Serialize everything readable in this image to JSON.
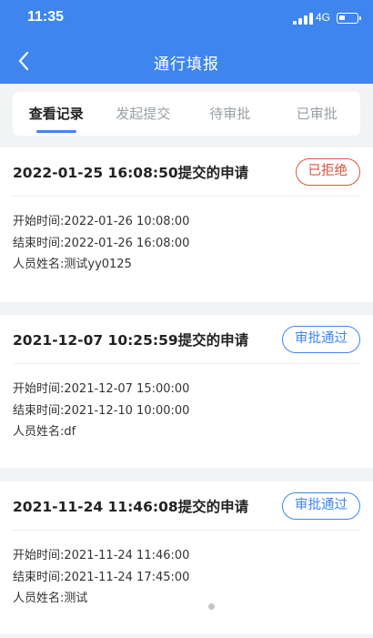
{
  "status_bar": {
    "time": "11:35",
    "network": "4G"
  },
  "header": {
    "title": "通行填报"
  },
  "tabs": [
    {
      "label": "查看记录",
      "active": true
    },
    {
      "label": "发起提交",
      "active": false
    },
    {
      "label": "待审批",
      "active": false
    },
    {
      "label": "已审批",
      "active": false
    }
  ],
  "records": [
    {
      "title": "2022-01-25 16:08:50提交的申请",
      "status": "已拒绝",
      "status_type": "rejected",
      "start": "开始时间:2022-01-26 10:08:00",
      "end": "结束时间:2022-01-26 16:08:00",
      "name": "人员姓名:测试yy0125"
    },
    {
      "title": "2021-12-07 10:25:59提交的申请",
      "status": "审批通过",
      "status_type": "approved",
      "start": "开始时间:2021-12-07 15:00:00",
      "end": "结束时间:2021-12-10 10:00:00",
      "name": "人员姓名:df"
    },
    {
      "title": "2021-11-24 11:46:08提交的申请",
      "status": "审批通过",
      "status_type": "approved",
      "start": "开始时间:2021-11-24 11:46:00",
      "end": "结束时间:2021-11-24 17:45:00",
      "name": "人员姓名:测试"
    }
  ],
  "colors": {
    "primary": "#3e86ee",
    "rejected": "#e0533c",
    "background": "#f2f3f5"
  }
}
